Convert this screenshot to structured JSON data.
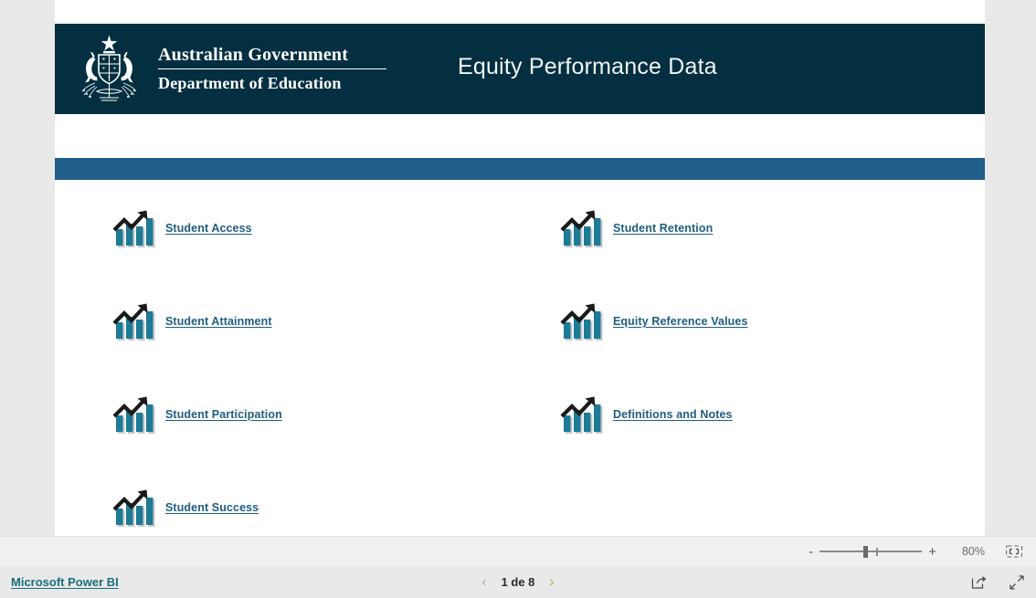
{
  "window": {
    "background_color": "#e9e9e9",
    "page_background": "#ffffff"
  },
  "banner": {
    "background_color": "#032f41",
    "crest_icon": "australian-coat-of-arms",
    "government_line1": "Australian Government",
    "government_line2": "Department of Education",
    "title": "Equity Performance Data"
  },
  "accent_bar": {
    "color": "#215f8a"
  },
  "navigation": {
    "link_color": "#1f5d82",
    "icon": "bar-chart-growth-icon",
    "items": [
      {
        "label": "Student Access",
        "column": "left",
        "row": 1
      },
      {
        "label": "Student Retention",
        "column": "right",
        "row": 1
      },
      {
        "label": "Student Attainment",
        "column": "left",
        "row": 2
      },
      {
        "label": "Equity Reference Values",
        "column": "right",
        "row": 2
      },
      {
        "label": "Student Participation",
        "column": "left",
        "row": 3
      },
      {
        "label": "Definitions and Notes",
        "column": "right",
        "row": 3
      },
      {
        "label": "Student Success",
        "column": "left",
        "row": 4
      }
    ]
  },
  "zoom_bar": {
    "minus_label": "-",
    "plus_label": "+",
    "percent": "80%",
    "fit_icon": "fit-to-page-icon"
  },
  "status_bar": {
    "powerbi_label": "Microsoft Power BI",
    "prev_icon": "chevron-left-icon",
    "next_icon": "chevron-right-icon",
    "page_text": "1 de 8",
    "share_icon": "share-icon",
    "fullscreen_icon": "fullscreen-icon"
  }
}
